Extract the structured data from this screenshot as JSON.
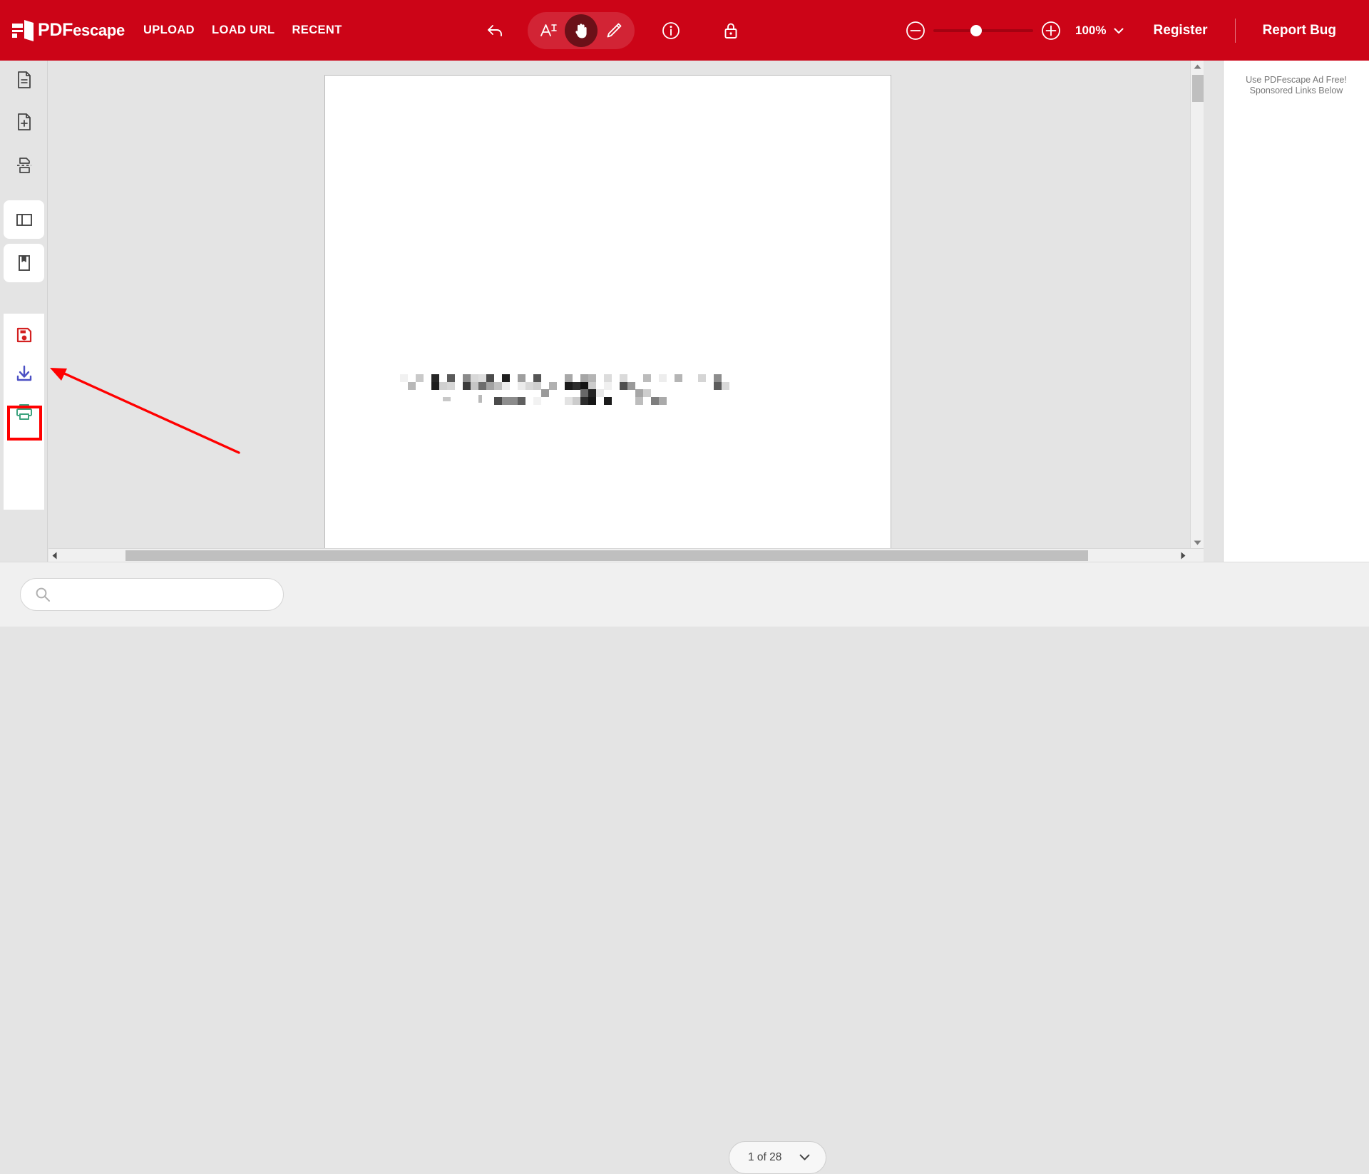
{
  "app": {
    "name": "PDFescape",
    "logo_text_bold": "PDF",
    "logo_text_light": "escape",
    "brand_red": "#cc0417",
    "highlight_red": "#ff0000"
  },
  "header": {
    "nav": [
      {
        "label": "UPLOAD",
        "name": "nav-upload"
      },
      {
        "label": "LOAD URL",
        "name": "nav-load-url"
      },
      {
        "label": "RECENT",
        "name": "nav-recent"
      }
    ],
    "tools": {
      "undo": "undo-icon",
      "text": "text-tool-icon",
      "hand": "hand-tool-icon",
      "pencil": "pencil-tool-icon",
      "info": "info-icon",
      "lock": "lock-icon",
      "active_tool": "hand-tool-icon"
    },
    "zoom": {
      "minus": "zoom-out-icon",
      "plus": "zoom-in-icon",
      "value": "100%",
      "caret": "chevron-down-icon"
    },
    "actions": {
      "register": "Register",
      "report_bug": "Report Bug"
    }
  },
  "sidebar": {
    "items": [
      {
        "name": "sidebar-item-page-view",
        "icon": "document-page-icon",
        "color": "#454545"
      },
      {
        "name": "sidebar-item-insert-page",
        "icon": "document-add-icon",
        "color": "#454545"
      },
      {
        "name": "sidebar-item-split-page",
        "icon": "document-split-icon",
        "color": "#454545"
      },
      {
        "name": "sidebar-item-toggle-panel",
        "icon": "sidebar-panel-icon",
        "color": "#454545"
      },
      {
        "name": "sidebar-item-bookmarks",
        "icon": "bookmark-icon",
        "color": "#454545"
      },
      {
        "name": "sidebar-item-save",
        "icon": "save-disk-icon",
        "color": "#d32020"
      },
      {
        "name": "sidebar-item-download",
        "icon": "download-icon",
        "color": "#4b4fc4"
      },
      {
        "name": "sidebar-item-print",
        "icon": "printer-icon",
        "color": "#3ea37f"
      }
    ],
    "highlighted_item": "sidebar-item-download"
  },
  "annotation": {
    "arrow": "red-pointer-arrow",
    "target": "sidebar-item-download",
    "color": "#ff0000"
  },
  "document": {
    "page_content": "redacted-pixelated-text",
    "page_background": "#ffffff"
  },
  "ad_panel": {
    "line1": "Use PDFescape Ad Free!",
    "line2": "Sponsored Links Below"
  },
  "scrollbars": {
    "vertical": {
      "up": "scroll-up-arrow-icon",
      "down": "scroll-down-arrow-icon"
    },
    "horizontal": {
      "left": "scroll-left-arrow-icon",
      "right": "scroll-right-arrow-icon"
    }
  },
  "bottom_bar": {
    "search": {
      "value": "",
      "placeholder": "",
      "icon": "search-icon"
    },
    "page_select": {
      "label": "1 of 28",
      "caret": "chevron-down-icon"
    }
  }
}
